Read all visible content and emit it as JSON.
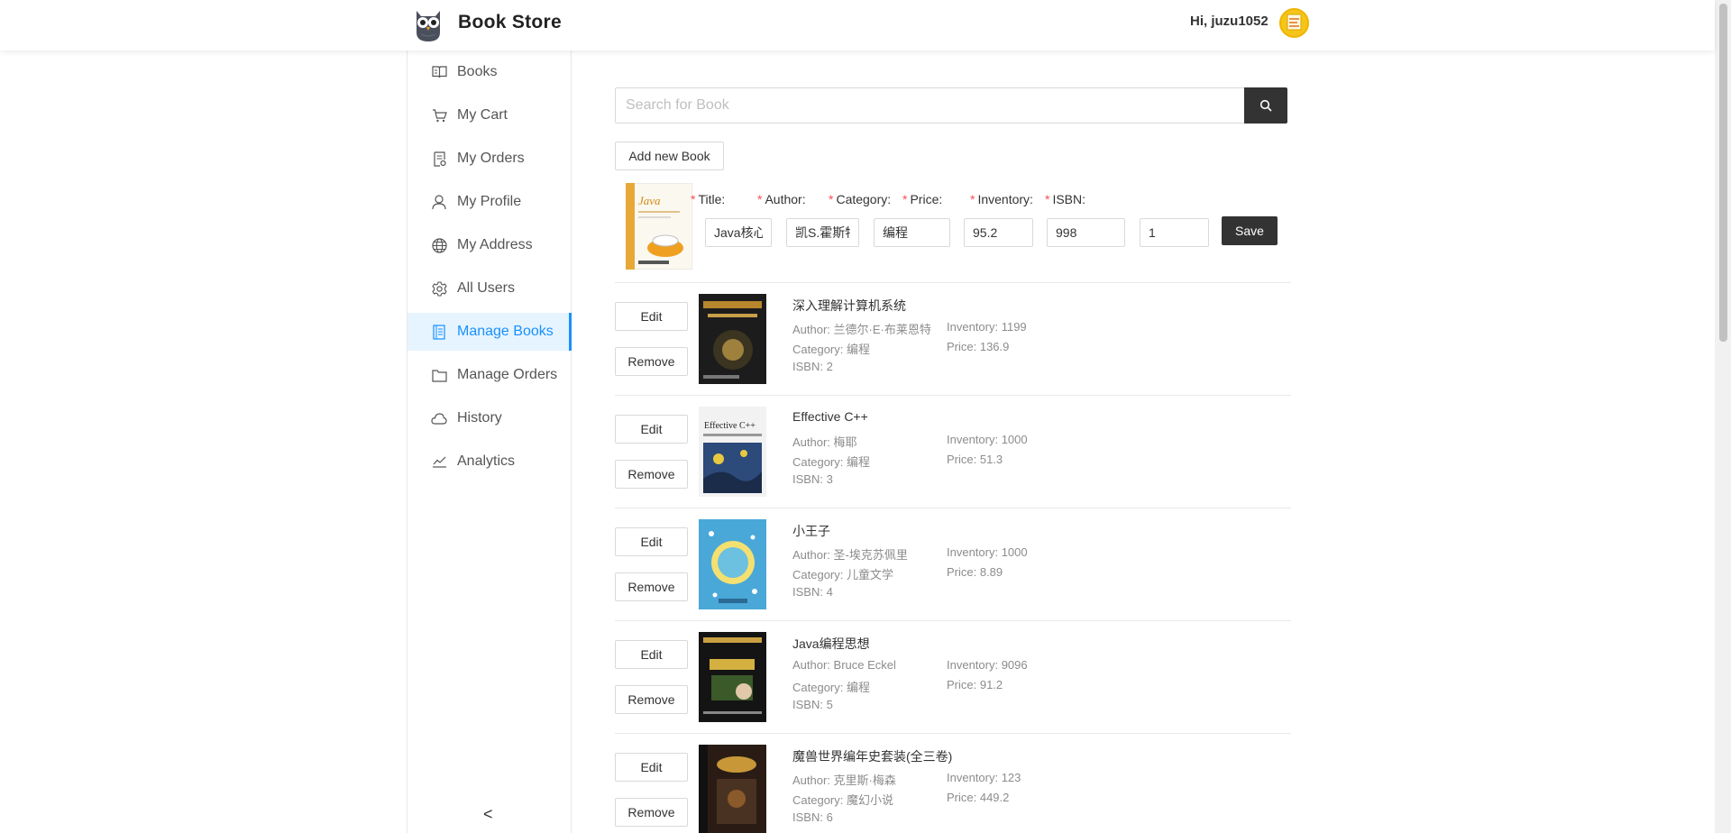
{
  "header": {
    "brand": "Book Store",
    "greeting": "Hi, juzu1052"
  },
  "sidebar": {
    "items": [
      {
        "label": "Books",
        "icon": "book-icon"
      },
      {
        "label": "My Cart",
        "icon": "cart-icon"
      },
      {
        "label": "My Orders",
        "icon": "orders-icon"
      },
      {
        "label": "My Profile",
        "icon": "user-icon"
      },
      {
        "label": "My Address",
        "icon": "globe-icon"
      },
      {
        "label": "All Users",
        "icon": "gear-icon"
      },
      {
        "label": "Manage Books",
        "icon": "manage-books-icon",
        "active": true
      },
      {
        "label": "Manage Orders",
        "icon": "folder-icon"
      },
      {
        "label": "History",
        "icon": "cloud-icon"
      },
      {
        "label": "Analytics",
        "icon": "chart-line-icon"
      }
    ],
    "collapse": "<"
  },
  "search": {
    "placeholder": "Search for Book"
  },
  "add_button": "Add new Book",
  "edit_form": {
    "fields": [
      {
        "label": "Title:",
        "value": "Java核心"
      },
      {
        "label": "Author:",
        "value": "凯S.霍斯特"
      },
      {
        "label": "Category:",
        "value": "编程"
      },
      {
        "label": "Price:",
        "value": "95.2"
      },
      {
        "label": "Inventory:",
        "value": "998"
      },
      {
        "label": "ISBN:",
        "value": "1"
      }
    ],
    "save": "Save"
  },
  "book_buttons": {
    "edit": "Edit",
    "remove": "Remove"
  },
  "books": [
    {
      "title": "深入理解计算机系统",
      "author": "Author: 兰德尔·E·布莱恩特",
      "category": "Category: 编程",
      "isbn": "ISBN: 2",
      "inventory": "Inventory: 1199",
      "price": "Price: 136.9"
    },
    {
      "title": "Effective C++",
      "author": "Author: 梅耶",
      "category": "Category: 编程",
      "isbn": "ISBN: 3",
      "inventory": "Inventory: 1000",
      "price": "Price: 51.3"
    },
    {
      "title": "小王子",
      "author": "Author: 圣-埃克苏佩里",
      "category": "Category: 儿童文学",
      "isbn": "ISBN: 4",
      "inventory": "Inventory: 1000",
      "price": "Price: 8.89"
    },
    {
      "title": "Java编程思想",
      "author": "Author: Bruce Eckel",
      "category": "Category: 编程",
      "isbn": "ISBN: 5",
      "inventory": "Inventory: 9096",
      "price": "Price: 91.2"
    },
    {
      "title": "魔兽世界编年史套装(全三卷)",
      "author": "Author: 克里斯·梅森",
      "category": "Category: 魔幻小说",
      "isbn": "ISBN: 6",
      "inventory": "Inventory: 123",
      "price": "Price: 449.2"
    }
  ]
}
